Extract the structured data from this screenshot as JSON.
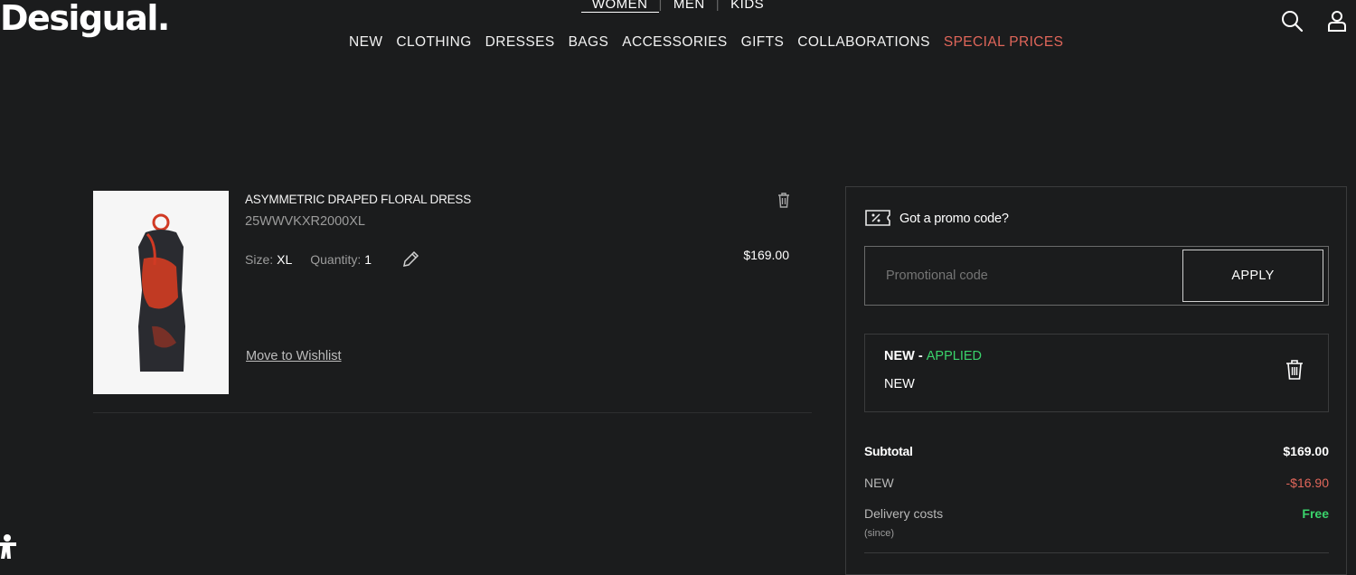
{
  "header": {
    "logo": "Desigual.",
    "genders": [
      "WOMEN",
      "MEN",
      "KIDS"
    ],
    "nav": [
      "NEW",
      "CLOTHING",
      "DRESSES",
      "BAGS",
      "ACCESSORIES",
      "GIFTS",
      "COLLABORATIONS"
    ],
    "special": "SPECIAL PRICES",
    "icons": [
      "search-icon",
      "user-icon"
    ]
  },
  "product": {
    "name": "ASYMMETRIC DRAPED FLORAL DRESS",
    "ref": "25WWVKXR2000XL",
    "size_label": "Size:",
    "size": "XL",
    "qty_label": "Quantity:",
    "qty": "1",
    "price": "$169.00",
    "wishlist": "Move to Wishlist"
  },
  "summary": {
    "promo_title": "Got a promo code?",
    "promo_placeholder": "Promotional code",
    "apply": "APPLY",
    "applied_code": "NEW",
    "applied_sep": " - ",
    "applied_status": "APPLIED",
    "applied_desc": "NEW",
    "subtotal_label": "Subtotal",
    "subtotal": "$169.00",
    "discount_label": "NEW",
    "discount": "-$16.90",
    "delivery_label": "Delivery costs",
    "delivery": "Free",
    "delivery_note": "(since)"
  },
  "colors": {
    "background": "#1b1c1d",
    "special": "#e0665a",
    "applied": "#3ad36b",
    "discount": "#e0665a"
  }
}
